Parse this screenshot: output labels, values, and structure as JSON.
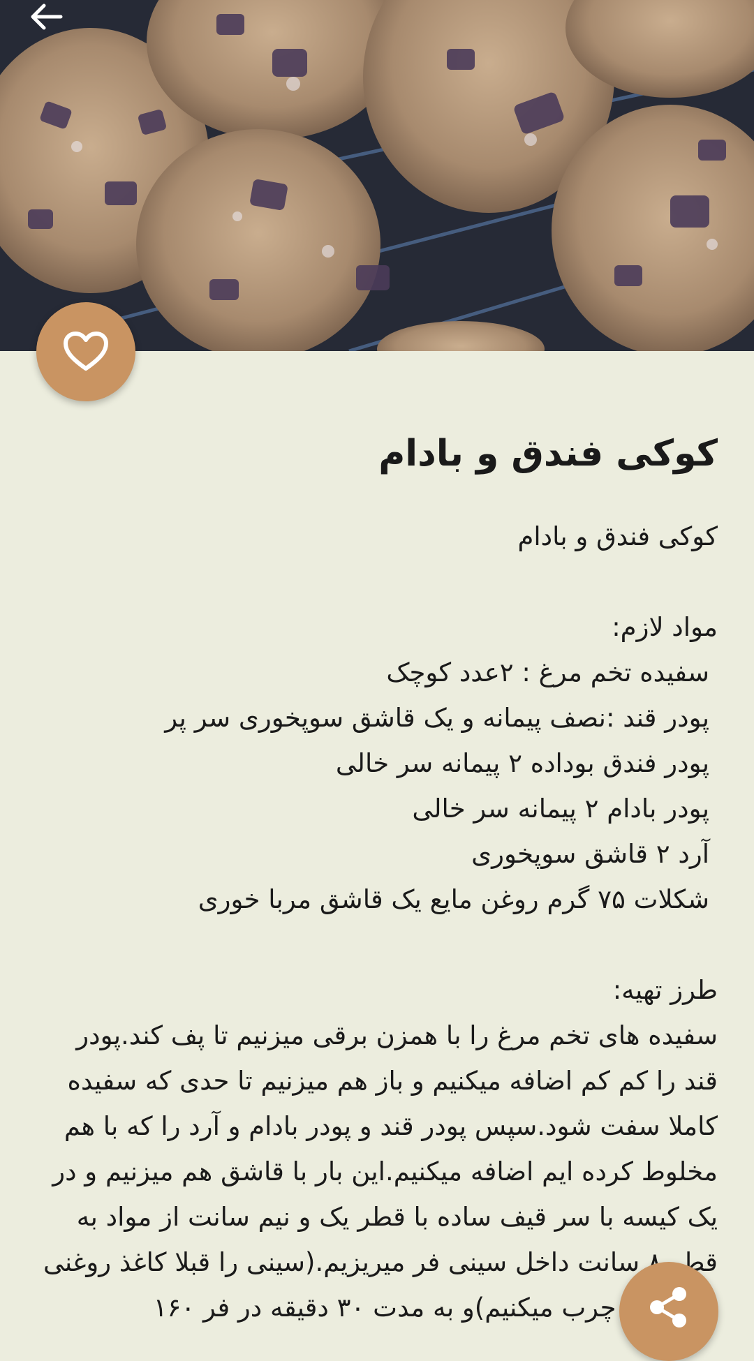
{
  "header": {
    "back_icon": "arrow-left-icon",
    "image_alt": "cookies-photo"
  },
  "actions": {
    "like_icon": "heart-outline-icon",
    "share_icon": "share-icon",
    "accent_color": "#c99462"
  },
  "recipe": {
    "title": "کوکی فندق و بادام",
    "subtitle": "کوکی فندق و بادام",
    "ingredients_heading": "مواد لازم:",
    "ingredients": [
      "سفیده تخم مرغ : ۲عدد کوچک",
      "پودر قند :نصف پیمانه و یک قاشق سوپخوری سر پر",
      "پودر فندق بوداده ۲ پیمانه سر خالی",
      "پودر بادام ۲ پیمانه سر خالی",
      "آرد ۲ قاشق سوپخوری",
      "شکلات ۷۵ گرم روغن مایع یک قاشق مربا خوری"
    ],
    "method_heading": "طرز تهیه:",
    "method": "سفیده های تخم مرغ را با همزن برقی میزنیم تا پف کند.پودر قند را کم کم اضافه میکنیم و باز هم میزنیم تا حدی که سفیده کاملا سفت شود.سپس پودر قند و پودر بادام و آرد را که با هم مخلوط کرده ایم اضافه میکنیم.این بار با قاشق هم میزنیم و در یک کیسه با سر قیف ساده با قطر یک و نیم سانت از مواد به قطر ۸ سانت داخل سینی فر میریزیم.(سینی را قبلا کاغذ روغنی انداخته و چرب میکنیم)و به مدت ۳۰ دقیقه در فر ۱۶۰"
  }
}
